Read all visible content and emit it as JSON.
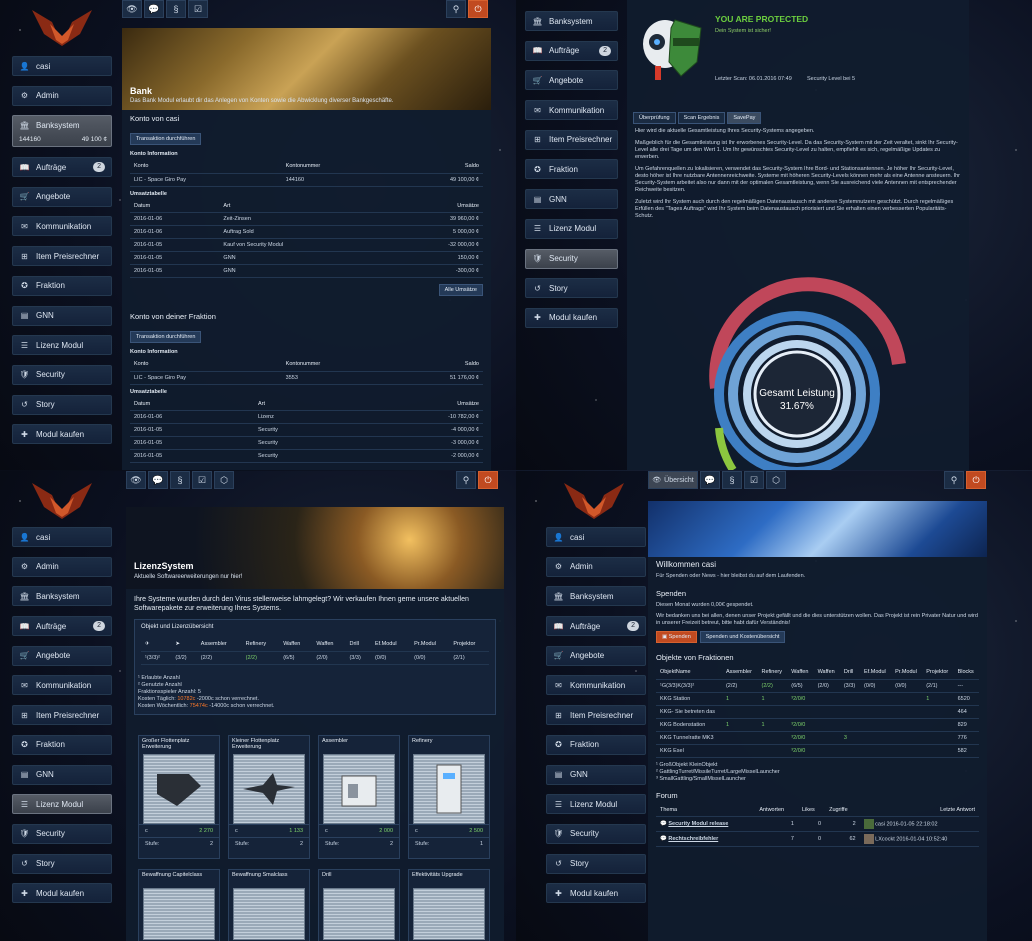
{
  "nav": {
    "casi": "casi",
    "admin": "Admin",
    "bank": "Banksystem",
    "auftraege": "Aufträge",
    "auftraege_badge": "2",
    "angebote": "Angebote",
    "kommunikation": "Kommunikation",
    "preis": "Item Preisrechner",
    "fraktion": "Fraktion",
    "gnn": "GNN",
    "lizenz": "Lizenz Modul",
    "security": "Security",
    "story": "Story",
    "modul": "Modul kaufen"
  },
  "bank_widget": {
    "left": "144160",
    "right": "49 100 ¢"
  },
  "icons": {
    "eye": "eye-icon",
    "chat": "chat-icon",
    "para": "§",
    "check": "check-icon",
    "cube": "cube-icon",
    "pin": "pin-icon",
    "power": "power-icon"
  },
  "colors": {
    "accent": "#c14a20",
    "green": "#7ed36b",
    "orange": "#ff7a2a",
    "ring_red": "#c0475a",
    "ring_blue": "#6fa3d6"
  },
  "bank": {
    "title": "Bank",
    "subtitle": "Das Bank Modul erlaubt dir das Anlegen von Konten sowie die Abwicklung diverser Bankgeschäfte.",
    "own_title": "Konto von casi",
    "btn_tx": "Transaktion durchführen",
    "info": "Konto Information",
    "h_konto": "Konto",
    "h_nummer": "Kontonummer",
    "h_saldo": "Saldo",
    "own_konto": "LIC - Space Giro Pay",
    "own_nummer": "144160",
    "own_saldo": "49 100,00 ¢",
    "umsatz": "Umsatztabelle",
    "h_datum": "Datum",
    "h_art": "Art",
    "h_umsatz": "Umsätze",
    "own_rows": [
      [
        "2016-01-06",
        "Zeit-Zinsen",
        "39 960,00 ¢"
      ],
      [
        "2016-01-06",
        "Auftrag Sold",
        "5 000,00 ¢"
      ],
      [
        "2016-01-05",
        "Kauf von Security Modul",
        "-32 000,00 ¢"
      ],
      [
        "2016-01-05",
        "GNN",
        "150,00 ¢"
      ],
      [
        "2016-01-05",
        "GNN",
        "-300,00 ¢"
      ]
    ],
    "all_btn": "Alle Umsätze",
    "frak_title": "Konto von deiner Fraktion",
    "frak_konto": "LIC - Space Giro Pay",
    "frak_nummer": "3553",
    "frak_saldo": "51 176,00 ¢",
    "frak_rows": [
      [
        "2016-01-06",
        "Lizenz",
        "-10 782,00 ¢"
      ],
      [
        "2016-01-05",
        "Security",
        "-4 000,00 ¢"
      ],
      [
        "2016-01-05",
        "Security",
        "-3 000,00 ¢"
      ],
      [
        "2016-01-05",
        "Security",
        "-2 000,00 ¢"
      ]
    ]
  },
  "security": {
    "status": "YOU ARE PROTECTED",
    "status_sub": "Dein System ist sicher!",
    "scan": "Letzter Scan: 06.01.2016 07:49",
    "level": "Security Level bei 5",
    "tabs": [
      "Überprüfung",
      "Scan Ergebnis",
      "SavePay"
    ],
    "p1": "Hier wird die aktuelle Gesamtleistung Ihres Security-Systems angegeben.",
    "p2": "Maßgeblich für die Gesamtleistung ist Ihr erworbenes Security-Level. Da das Security-System mit der Zeit veraltet, sinkt Ihr Security-Level alle drei Tage um den Wert 1. Um Ihr gewünschtes Security-Level zu halten, empfiehlt es sich, regelmäßige Updates zu erwerben.",
    "p3": "Um Gefahrenquellen zu lokalisieren, verwendet das Security-System Ihre Bord- und Stationsantennen. Je höher Ihr Security-Level, desto höher ist Ihre nutzbare Antennenreichweite. Systeme mit höheren Security-Levels können mehr als eine Antenne ansteuern. Ihr Security-System arbeitet also nur dann mit der optimalen Gesamtleistung, wenn Sie ausreichend viele Antennen mit entsprechender Reichweite besitzen.",
    "p4": "Zuletzt wird Ihr System auch durch den regelmäßigen Datenaustausch mit anderen Systemnutzern geschützt. Durch regelmäßiges Erfüllen des \"Tages Auftrags\" wird Ihr System beim Datenaustausch priorisiert und Sie erhalten einen verbesserten Popularitäts-Schutz.",
    "gauge_label": "Gesamt Leistung",
    "gauge_value": "31.67%"
  },
  "lizenz": {
    "title": "LizenzSystem",
    "subtitle": "Aktuelle Softwareerweiterungen nur hier!",
    "intro": "Ihre Systeme wurden durch den Virus stellenweise lahmgelegt? Wir verkaufen Ihnen gerne unsere aktuellen Softwarepakete zur erweiterung Ihres Systems.",
    "overview": "Objekt und Lizenzübersicht",
    "cols": [
      "Assembler",
      "Refinery",
      "Waffen",
      "Waffen",
      "Drill",
      "Ef.Modul",
      "Pr.Modul",
      "Projektor"
    ],
    "vals": [
      "¹(3/3)²",
      "(3/2)",
      "(2/2)",
      "(2/2)",
      "(6/5)",
      "(2/0)",
      "(3/3)",
      "(0/0)",
      "(0/0)",
      "(2/1)"
    ],
    "notes": [
      "¹ Erlaubte Anzahl",
      "² Genutzte Anzahl",
      "Fraktionsspieler Anzahl: 5"
    ],
    "cost_daily_pre": "Kosten Täglich: ",
    "cost_daily": "10782c",
    "cost_daily_post": " -2000c schon verrechnet.",
    "cost_weekly_pre": "Kosten Wöchentlich: ",
    "cost_weekly": "75474c",
    "cost_weekly_post": " -14000c schon verrechnet.",
    "cards": [
      {
        "t": "Großer Flottenplatz Erweiterung",
        "p": "2 270",
        "s": "2"
      },
      {
        "t": "Kleiner Flottenplatz Erweiterung",
        "p": "1 133",
        "s": "2"
      },
      {
        "t": "Assembler",
        "p": "2 000",
        "s": "2"
      },
      {
        "t": "Refinery",
        "p": "2 500",
        "s": "1"
      }
    ],
    "cards2": [
      "Bewaffnung Capitelclass",
      "Bewaffnung Smalclass",
      "Drill",
      "Effektivitäts Upgrade"
    ],
    "c": "c",
    "stufe": "Stufe:"
  },
  "home": {
    "tab": "Übersicht",
    "title": "Willkommen casi",
    "subtitle": "Für Spenden oder News - hier bleibst du auf dem Laufenden.",
    "spenden": "Spenden",
    "month": "Diesen Monat wurden 0,00€ gespendet.",
    "thanks": "Wir bedanken uns bei allen, denen unser Projekt gefällt und die dies unterstützen wollen. Das Projekt ist rein Privater Natur und wird in unserer Freizeit betreut, bitte habt dafür Verständnis!",
    "btn_spenden": "Spenden",
    "btn_kosten": "Spenden und Kostenübersicht",
    "obj_title": "Objekte von Fraktionen",
    "obj_cols": [
      "ObjektName",
      "Assembler",
      "Refinery",
      "Waffen",
      "Waffen",
      "Drill",
      "Ef.Modul",
      "Pr.Modul",
      "Projektor",
      "Blocks"
    ],
    "obj_hdr": [
      "¹G(3/3)K(3/3)²",
      "(2/2)",
      "(2/2)",
      "(6/5)",
      "(2/0)",
      "(3/3)",
      "(0/0)",
      "(0/0)",
      "(2/1)",
      "---"
    ],
    "obj_rows": [
      [
        "KKG Station",
        "1",
        "1",
        "³2/0/0",
        "",
        "",
        "",
        "",
        "1",
        "6520"
      ],
      [
        "KKG- Sie betreten das",
        "",
        "",
        "",
        "",
        "",
        "",
        "",
        "",
        "464"
      ],
      [
        "KKG Bodenstation",
        "1",
        "1",
        "³2/0/0",
        "",
        "",
        "",
        "",
        "",
        "829"
      ],
      [
        "KKG Tunnelratte MK3",
        "",
        "",
        "³2/0/0",
        "",
        "3",
        "",
        "",
        "",
        "776"
      ],
      [
        "KKG Esel",
        "",
        "",
        "³2/0/0",
        "",
        "",
        "",
        "",
        "",
        "582"
      ]
    ],
    "foot": [
      "¹ GroßObjekt KleinObjekt",
      "² GattlingTurret/MissileTurret/LargeMisselLauncher",
      "³ SmallGattling/SmallMisselLauncher"
    ],
    "forum": "Forum",
    "f_cols": [
      "Thema",
      "Antworten",
      "Likes",
      "Zugriffe",
      "Letzte Antwort"
    ],
    "f_rows": [
      {
        "t": "Security Modul release",
        "a": "1",
        "l": "0",
        "z": "2",
        "u": "casi",
        "d": "2016-01-05 22:18:02"
      },
      {
        "t": "Rechtschreibfehler",
        "a": "7",
        "l": "0",
        "z": "62",
        "u": "LXcockt",
        "d": "2016-01-04 10:52:40"
      }
    ]
  }
}
